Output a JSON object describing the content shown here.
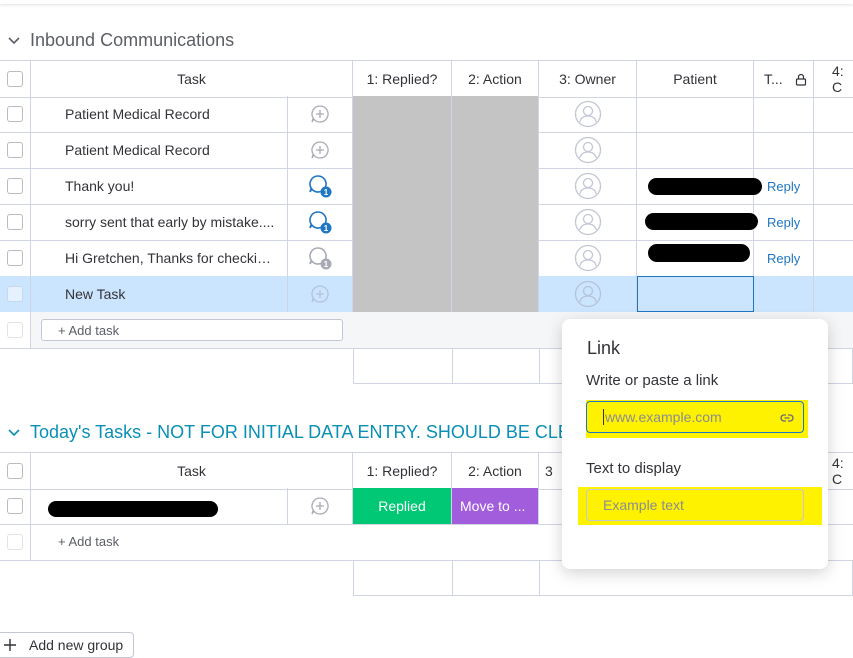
{
  "groups": [
    {
      "title": "Inbound Communications",
      "columns": {
        "task": "Task",
        "replied": "1: Replied?",
        "action": "2: Action",
        "owner": "3: Owner",
        "patient": "Patient",
        "t": "T...",
        "col4": "4: C"
      },
      "rows": [
        {
          "task": "Patient Medical Record",
          "reply": ""
        },
        {
          "task": "Patient Medical Record",
          "reply": ""
        },
        {
          "task": "Thank you!",
          "reply": "Reply",
          "update_count": "1"
        },
        {
          "task": "sorry sent that early by mistake....",
          "reply": "Reply",
          "update_count": "1"
        },
        {
          "task": "Hi Gretchen, Thanks for checkin...",
          "reply": "Reply",
          "update_count": "1"
        },
        {
          "task": "New Task",
          "reply": ""
        }
      ],
      "add_task": "+ Add task"
    },
    {
      "title": "Today's Tasks - NOT FOR INITIAL DATA ENTRY. SHOULD BE CLEA",
      "columns": {
        "task": "Task",
        "replied": "1: Replied?",
        "action": "2: Action",
        "owner": "3",
        "col4": "4: C"
      },
      "rows": [
        {
          "replied": "Replied",
          "action": "Move to ..."
        }
      ],
      "add_task": "+ Add task"
    }
  ],
  "link_popup": {
    "title": "Link",
    "link_label": "Write or paste a link",
    "link_placeholder": "www.example.com",
    "display_label": "Text to display",
    "display_placeholder": "Example text"
  },
  "add_new_group": "Add new group",
  "colors": {
    "replied_green": "#00c875",
    "action_purple": "#a25ddc",
    "gray_cell": "#c4c4c4",
    "selected_row": "#cce5ff",
    "highlight_yellow": "#fff200",
    "link_blue": "#1f76c2"
  }
}
